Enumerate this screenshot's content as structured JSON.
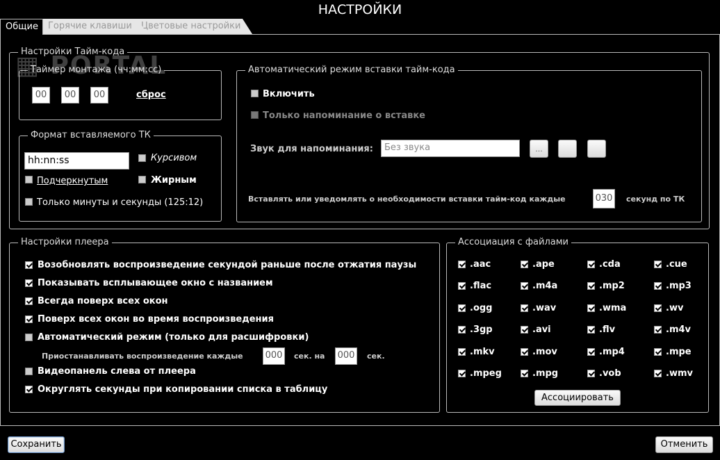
{
  "window": {
    "title": "НАСТРОЙКИ"
  },
  "tabs": [
    {
      "label": "Общие"
    },
    {
      "label": "Горячие клавиши"
    },
    {
      "label": "Цветовые настройки"
    }
  ],
  "timecode": {
    "legend": "Настройки Тайм-кода",
    "timer": {
      "legend": "Таймер монтажа (чч:мм:сс)",
      "hh": "00",
      "mm": "00",
      "ss": "00",
      "reset_label": "сброс"
    },
    "format": {
      "legend": "Формат вставляемого ТК",
      "value": "hh:nn:ss",
      "italic_label": "Курсивом",
      "underline_label": "Подчеркнутым",
      "bold_label": "Жирным",
      "minsec_label": "Только минуты и секунды (125:12)"
    },
    "auto": {
      "legend": "Автоматический режим вставки тайм-кода",
      "enable_label": "Включить",
      "reminder_label": "Только напоминание о вставке",
      "sound_label": "Звук для напоминания:",
      "sound_placeholder": "Без звука",
      "browse_label": "...",
      "interval_prefix": "Вставлять или уведомлять о необходимости вставки тайм-код каждые",
      "interval_value": "030",
      "interval_suffix": "секунд по ТК"
    }
  },
  "player": {
    "legend": "Настройки плеера",
    "options": [
      {
        "label": "Возобновлять воспроизведение секундой раньше после отжатия паузы",
        "checked": true
      },
      {
        "label": "Показывать всплывающее окно с названием",
        "checked": true
      },
      {
        "label": "Всегда поверх всех окон",
        "checked": true
      },
      {
        "label": "Поверх всех окон во время воспроизведения",
        "checked": true
      },
      {
        "label": "Автоматический режим (только для расшифровки)",
        "checked": false
      }
    ],
    "pause": {
      "prefix": "Приостанавливать воспроизведение каждые",
      "value1": "000",
      "mid": "сек. на",
      "value2": "000",
      "suffix": "сек."
    },
    "options2": [
      {
        "label": "Видеопанель слева от плеера",
        "checked": false
      },
      {
        "label": "Округлять секунды при копировании списка в таблицу",
        "checked": true
      }
    ]
  },
  "assoc": {
    "legend": "Ассоциация с файлами",
    "exts": [
      ".aac",
      ".ape",
      ".cda",
      ".cue",
      ".flac",
      ".m4a",
      ".mp2",
      ".mp3",
      ".ogg",
      ".wav",
      ".wma",
      ".wv",
      ".3gp",
      ".avi",
      ".flv",
      ".m4v",
      ".mkv",
      ".mov",
      ".mp4",
      ".mpe",
      ".mpeg",
      ".mpg",
      ".vob",
      ".wmv"
    ],
    "button_label": "Ассоциировать"
  },
  "footer": {
    "save_label": "Сохранить",
    "cancel_label": "Отменить"
  },
  "watermark": "PORTAL"
}
